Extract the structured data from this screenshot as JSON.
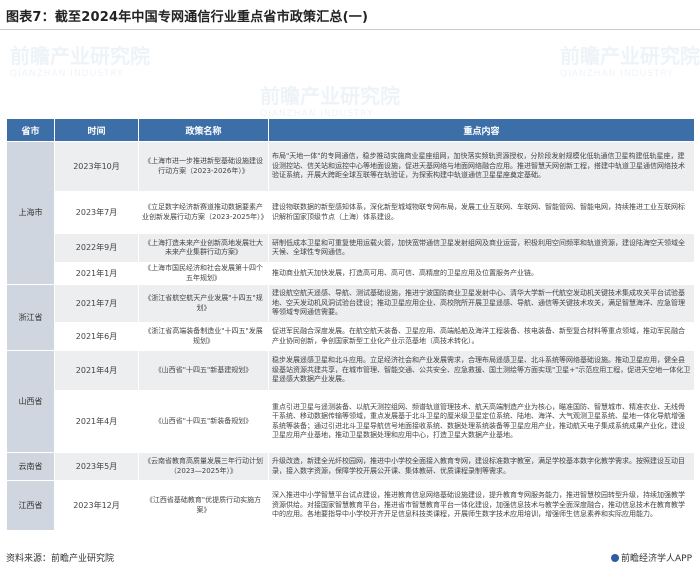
{
  "title": "图表7：截至2024年中国专网通信行业重点省市政策汇总(一)",
  "watermark": {
    "text": "前瞻产业研究院",
    "sub": "QIANZHAN INDUSTRY"
  },
  "table": {
    "headers": [
      "省市",
      "时间",
      "政策名称",
      "重点内容"
    ],
    "rows": [
      {
        "time": "2023年10月",
        "name": "《上海市进一步推进新型基础设施建设行动方案（2023-2026年）》",
        "key": "布局\"天地一体\"的专网通信，稳步推动实施商业星座组网，加快落实频轨资源授权，分阶段发射规模化低轨通信卫星构建低轨星座，建设测控站、信关站和运控中心等地面设施，促进天基网络与地面网络融合应用。推进智慧天网创新工程，搭建中轨道卫星通信网络技术验证系统，开展大跨距全球互联等在轨验证，为探索构建中轨道通信卫星星座奠定基础。"
      },
      {
        "time": "2023年7月",
        "name": "《立足数字经济新赛道推动数据要素产业创新发展行动方案（2023-2025年）》",
        "key": "建设物联数据的新型感知体系，深化新型城域物联专网布局，发展工业互联网、车联网、智能管网、智能电网，持续推进工业互联网标识解析国家顶级节点（上海）体系建设。"
      },
      {
        "time": "2022年9月",
        "name": "《上海打造未来产业创新高地发展壮大未来产业集群行动方案》",
        "key": "研制低成本卫星和可重复使用运载火箭，加快宽带通信卫星发射组网及商业运营，积极利用空间频率和轨道资源，建设陆海空天领域全天候、全球性专网通信。"
      },
      {
        "time": "2021年1月",
        "name": "《上海市国民经济和社会发展第十四个五年规划》",
        "key": "推动商业航天加快发展，打造高可用、高可信、高精度的卫星应用及位置服务产业链。"
      },
      {
        "time": "2021年7月",
        "name": "《浙江省航空航天产业发展\"十四五\"规划》",
        "key": "建设航空航天遥感、导航、测试基础设施，推进宁波国防商业卫星发射中心、清华大学新一代航空发动机关键技术集成攻关平台试验基地、空天发动机风洞试验台建设；推动卫星应用企业、高校院所开展卫星遥感、导航、通信等关键技术攻关，满足智慧海洋、应急管理等领域专网通信需要。"
      },
      {
        "time": "2021年6月",
        "name": "《浙江省高端装备制造业\"十四五\"发展规划》",
        "key": "促进军民融合深度发展。在航空航天装备、卫星应用、高端船舶及海洋工程装备、核电装备、新型复合材料等重点领域，推动军民融合产业协同创新，争创国家新型工业化产业示范基地（高技术转化）。"
      },
      {
        "time": "2021年4月",
        "name": "《山西省\"十四五\"新基建规划》",
        "key": "稳步发展遥感卫星和北斗应用。立足经济社会和产业发展需求，合理布局遥感卫星、北斗系统等网络基础设施。推动卫星应用，健全县级基站资源共建共享，在城市管理、智能交通、公共安全、应急救援、国土测绘等方面实现\"卫星+\"示范应用工程，促进天空地一体化卫星遥感大数据产业发展。"
      },
      {
        "time": "2021年4月",
        "name": "《山西省\"十四五\"新装备规划》",
        "key": "重点引进卫星与遥测装备、以航天测控组网、频谱轨道管理技术、航天高端制造产业为核心，瞄准国防、智慧城市、精准农业、无线骨干系统、移动数据传输等领域，重点发展基于北斗卫星的厘米级卫星定位系统、陆地、海洋、大气观测卫星系统、星地一体化导航增强系统等装备；通过引进北斗卫星导航信号地面接收系统、数据处理系统装备等卫星应用产业，推动航天电子集成系统成果产业化，建设卫星应用产业基地，推动卫星数据处理和应用中心，打造卫星大数据产业基地。"
      },
      {
        "time": "2023年5月",
        "name": "《云南省教育高质量发展三年行动计划（2023—2025年）》",
        "key": "升级改造，新建全光纤校园网，推进中小学校全面接入教育专网，建设标准数字教室，满足学校基本数字化教学需求。按照建设互动目录，接入数字资源，保障学校开展公开课、集体教研、优质课程录制等需求。"
      },
      {
        "time": "2023年12月",
        "name": "《江西省基础教育\"优提质行动实施方案》",
        "key": "深入推进中小学智慧平台试点建设，推进教育信息网络基础设施建设，提升教育专网服务能力，推进智慧校园转型升级，持续加强教学资源供给。对接国家智慧教育平台，推进省市智慧教育平台一体化建设，加强信息技术与教学全面深度融合，推动信息技术在教育教学中的应用。各地要指导中小学校开齐开足信息科技类课程，开展师生数字技术应用培训，增强师生信息素养和实际应用能力。"
      }
    ],
    "provinces": [
      "上海市",
      "浙江省",
      "山西省",
      "云南省",
      "江西省"
    ]
  },
  "footer": {
    "source": "资料来源：前瞻产业研究院",
    "logo": "前瞻经济学人APP"
  },
  "colors": {
    "header": "#3c6ea8",
    "province_bg": "#cfd6df",
    "row_alt": "#eceef0"
  }
}
